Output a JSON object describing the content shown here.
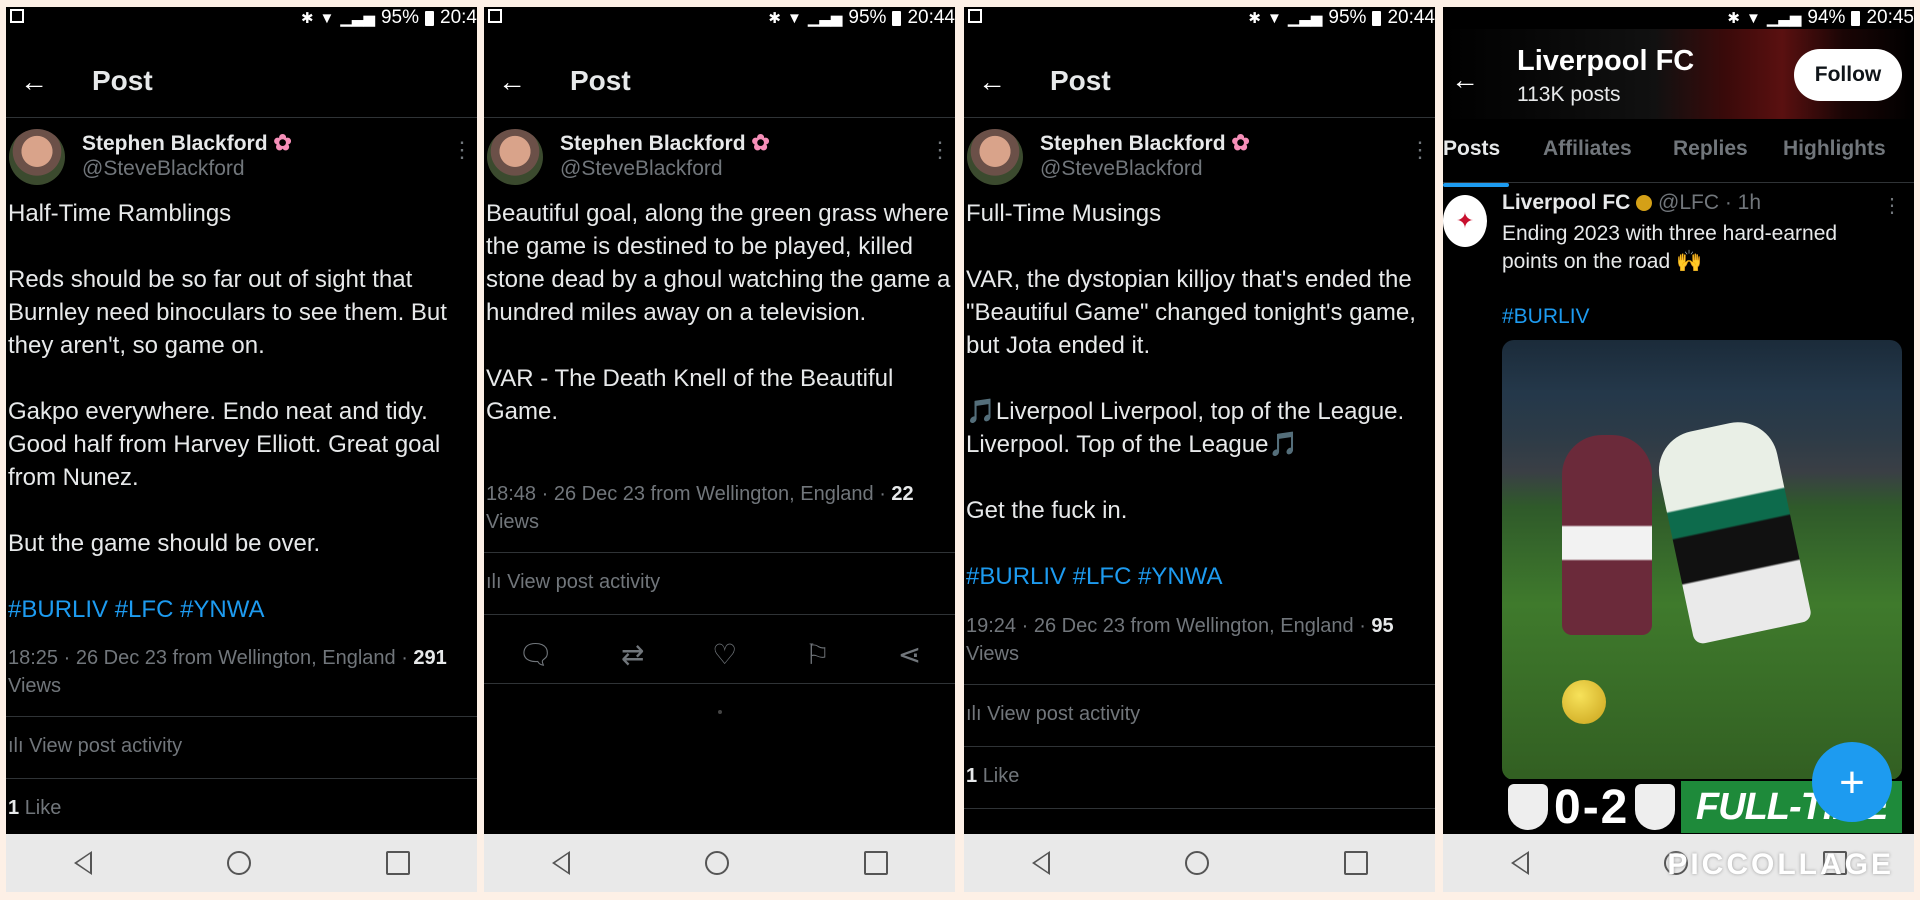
{
  "panels": [
    {
      "status": {
        "battery": "95%",
        "time": "20:4"
      },
      "header_title": "Post",
      "author": {
        "name": "Stephen Blackford",
        "handle": "@SteveBlackford"
      },
      "body": [
        "Half-Time Ramblings",
        "Reds should be so far out of sight that Burnley need binoculars to see them. But they aren't, so game on.",
        "Gakpo everywhere. Endo neat and tidy. Good half from Harvey Elliott. Great goal from Nunez.",
        "But the game should be over."
      ],
      "hashtags": "#BURLIV #LFC #YNWA",
      "meta": "18:25 · 26 Dec 23 from Wellington, England · ",
      "views_count": "291",
      "views_label": "Views",
      "activity": "View post activity",
      "likes_count": "1",
      "likes_label": "Like"
    },
    {
      "status": {
        "battery": "95%",
        "time": "20:44"
      },
      "header_title": "Post",
      "author": {
        "name": "Stephen Blackford",
        "handle": "@SteveBlackford"
      },
      "body": [
        "Beautiful goal, along the green grass where the game is destined to be played, killed stone dead by a ghoul watching the game a hundred miles away on a television.",
        "VAR - The Death Knell of the Beautiful Game."
      ],
      "meta": "18:48 · 26 Dec 23 from Wellington, England · ",
      "views_count": "22",
      "views_label": "Views",
      "activity": "View post activity"
    },
    {
      "status": {
        "battery": "95%",
        "time": "20:44"
      },
      "header_title": "Post",
      "author": {
        "name": "Stephen Blackford",
        "handle": "@SteveBlackford"
      },
      "body": [
        "Full-Time Musings",
        "VAR, the dystopian killjoy that's ended the \"Beautiful Game\" changed tonight's game, but Jota ended it.",
        "🎵Liverpool Liverpool, top of the League. Liverpool. Top of the League🎵",
        "Get the fuck in."
      ],
      "hashtags": "#BURLIV #LFC #YNWA",
      "meta": "19:24 · 26 Dec 23 from Wellington, England · ",
      "views_count": "95",
      "views_label": "Views",
      "activity": "View post activity",
      "likes_count": "1",
      "likes_label": "Like"
    }
  ],
  "profile": {
    "status": {
      "battery": "94%",
      "time": "20:45"
    },
    "title": "Liverpool FC",
    "posts_count": "113K posts",
    "follow_label": "Follow",
    "tabs": [
      "Posts",
      "Affiliates",
      "Replies",
      "Highlights"
    ],
    "tweet": {
      "name": "Liverpool FC",
      "handle_time": "@LFC · 1h",
      "text": "Ending 2023 with three hard-earned points on the road 🙌",
      "hashtag": "#BURLIV",
      "score": "0-2",
      "ft_text": "FULL-TIME"
    }
  },
  "watermark": "PICCOLLAGE",
  "colors": {
    "accent": "#1d9bf0",
    "background": "#000000",
    "muted": "#71767b"
  }
}
